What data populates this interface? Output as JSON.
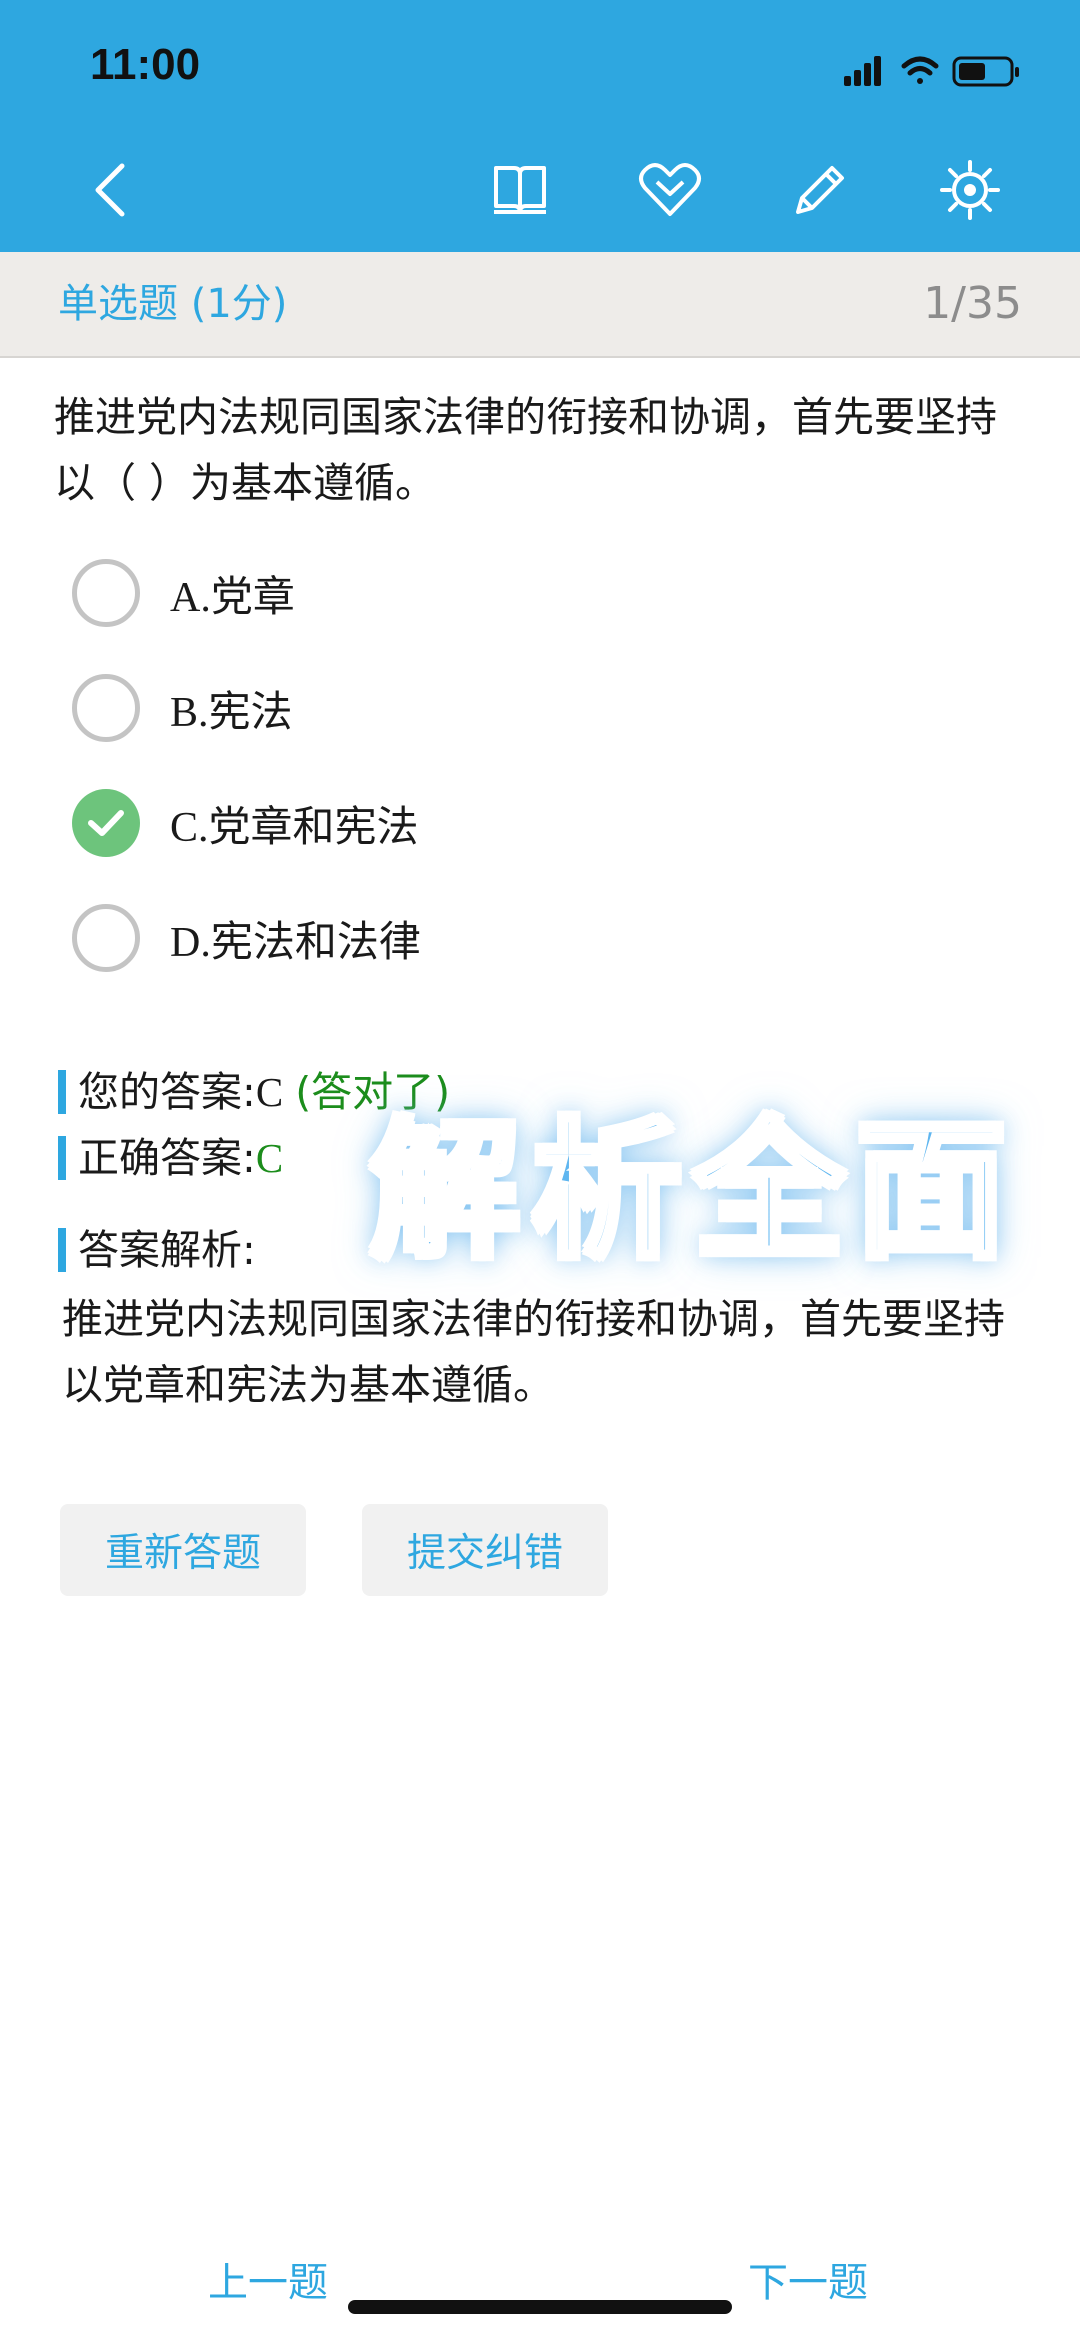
{
  "status_bar": {
    "time": "11:00"
  },
  "toolbar": {
    "icons": [
      "back-chevron-icon",
      "book-icon",
      "heart-icon",
      "pencil-icon",
      "settings-icon"
    ]
  },
  "subheader": {
    "question_type": "单选题 (1分)",
    "progress": "1/35"
  },
  "question": {
    "text": "推进党内法规同国家法律的衔接和协调，首先要坚持以（ ）为基本遵循。",
    "options": [
      {
        "label": "A.党章",
        "selected": false
      },
      {
        "label": "B.宪法",
        "selected": false
      },
      {
        "label": "C.党章和宪法",
        "selected": true
      },
      {
        "label": "D.宪法和法律",
        "selected": false
      }
    ]
  },
  "answer": {
    "your_answer_label": "您的答案:",
    "your_answer_value": "C",
    "result": "(答对了)",
    "correct_label": "正确答案:",
    "correct_value": "C",
    "analysis_label": "答案解析:",
    "analysis_text": "推进党内法规同国家法律的衔接和协调，首先要坚持以党章和宪法为基本遵循。"
  },
  "overlay": {
    "text": "解析全面"
  },
  "actions": {
    "retry": "重新答题",
    "report_error": "提交纠错"
  },
  "nav": {
    "prev": "上一题",
    "next": "下一题"
  },
  "colors": {
    "primary": "#2ea7e0",
    "correct_green": "#1c8d1c",
    "checked_radio": "#6dc47c",
    "subheader_bg": "#eeece9"
  }
}
